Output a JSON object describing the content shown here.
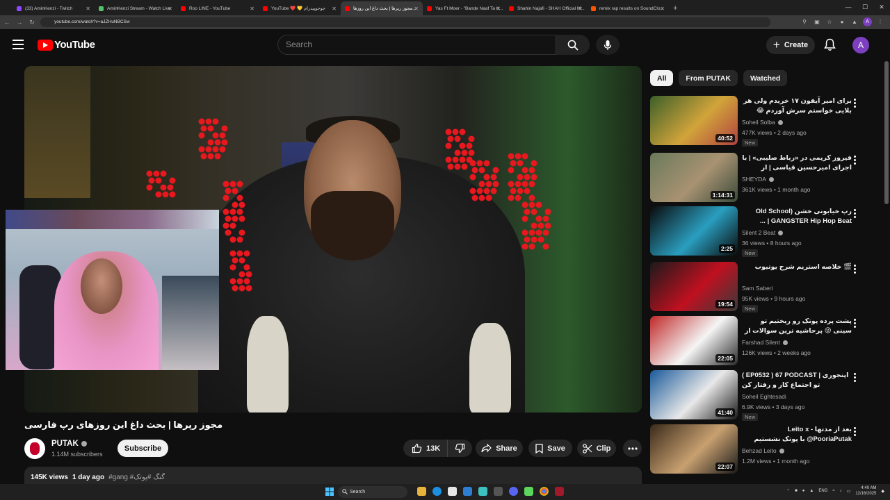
{
  "browser": {
    "tabs": [
      {
        "title": "(33) AminKenzi - Twitch",
        "color": "#9146ff",
        "active": false
      },
      {
        "title": "AminKenzi Stream - Watch Live",
        "color": "#53c16a",
        "active": false
      },
      {
        "title": "Roo LINE - YouTube",
        "color": "#ff0000",
        "active": false
      },
      {
        "title": "YouTube ❤️ 💛 جوجو‌پیدرام",
        "color": "#ff0000",
        "active": false
      },
      {
        "title": "مجوز رپرها | بحث داغ این روزها...",
        "color": "#ff0000",
        "active": true
      },
      {
        "title": "Yas Ft Moer - \"Bande Naaf Ta K...",
        "color": "#ff0000",
        "active": false
      },
      {
        "title": "Shahin Najafi - SHAH Official M...",
        "color": "#ff0000",
        "active": false
      },
      {
        "title": "remix rap results on SoundClo...",
        "color": "#ff5500",
        "active": false
      }
    ],
    "new_tab": "+",
    "url": "youtube.com/watch?v=aJZHuNBCSw"
  },
  "header": {
    "logo_text": "YouTube",
    "search_placeholder": "Search",
    "create_label": "Create",
    "account_initial": "A"
  },
  "video": {
    "title": "مجوز رپرها | بحث داغ این روزهای رپ فارسی",
    "channel": "PUTAK",
    "subscribers": "1.14M subscribers",
    "subscribe_label": "Subscribe",
    "likes": "13K",
    "share_label": "Share",
    "save_label": "Save",
    "clip_label": "Clip",
    "views": "145K views",
    "age": "1 day ago",
    "tags": "#gang #گنگ #پوتک"
  },
  "chips": [
    "All",
    "From PUTAK",
    "Watched"
  ],
  "recommendations": [
    {
      "title": "برای امیر آیفون ۱۷ خریدم ولی هر بلایی خواستم سرش آوردم 😂",
      "channel": "Soheil Solba",
      "verified": true,
      "meta": "477K views • 2 days ago",
      "badge": "New",
      "duration": "40:52",
      "thumb": [
        "#3c5f2a",
        "#d1a43a",
        "#b04040"
      ]
    },
    {
      "title": "فیروز کریمی در «رباط صلیبی» | با اجرای امیرحسین قیاسی | از پلتفرم شیدا",
      "channel": "SHEYDA",
      "verified": true,
      "meta": "361K views • 1 month ago",
      "badge": "",
      "duration": "1:14:31",
      "thumb": [
        "#6a7a5a",
        "#a89272",
        "#3a4a3a"
      ]
    },
    {
      "title": "رپ خیابونی خشن Old School) GANGSTER Hip Hop Beat | ...",
      "channel": "Silent 2 Beat",
      "verified": true,
      "meta": "36 views • 8 hours ago",
      "badge": "New",
      "duration": "2:25",
      "thumb": [
        "#0a0a0a",
        "#2a9ec0",
        "#0a0a0a"
      ]
    },
    {
      "title": "🎬 خلاصه استریم شرح یوتیوب",
      "channel": "Sam Saberi",
      "verified": false,
      "meta": "95K views • 9 hours ago",
      "badge": "New",
      "duration": "19:54",
      "thumb": [
        "#1a1a1a",
        "#c01020",
        "#3a3a3a"
      ]
    },
    {
      "title": "پشت پرده پوتک رو ریختیم تو سینی 😜 پرحاشیه ترین سوالات از پوتک",
      "channel": "Farshad Silent",
      "verified": true,
      "meta": "126K views • 2 weeks ago",
      "badge": "",
      "duration": "22:05",
      "thumb": [
        "#c02828",
        "#f5f5f5",
        "#2a2a2a"
      ]
    },
    {
      "title": "( EP0532 ) 67 PODCAST | اپنجوری تو اجتماع کار و رفتار کن",
      "channel": "Soheil Eghtesadi",
      "verified": false,
      "meta": "6.9K views • 3 days ago",
      "badge": "New",
      "duration": "41:40",
      "thumb": [
        "#1a5a9a",
        "#e8e8e8",
        "#1a1a1a"
      ]
    },
    {
      "title": "بعد از مدتها - Leito x @PooriaPutak با پوتک نشستیم",
      "channel": "Behzad Leito",
      "verified": true,
      "meta": "1.2M views • 1 month ago",
      "badge": "",
      "duration": "22:07",
      "thumb": [
        "#3a2a1a",
        "#c8a070",
        "#1a1a1a"
      ]
    }
  ],
  "taskbar": {
    "search_label": "Search",
    "lang": "ENG",
    "time": "4:40 AM",
    "date": "12/16/2025"
  },
  "colors": {
    "accent": "#ff0000",
    "background": "#0f0f0f",
    "overlay_dots": "#e8181e"
  },
  "icons": [
    "hamburger-icon",
    "youtube-logo-icon",
    "search-icon",
    "mic-icon",
    "plus-icon",
    "bell-icon",
    "like-icon",
    "dislike-icon",
    "share-icon",
    "save-icon",
    "clip-icon",
    "more-icon",
    "verified-icon",
    "windows-start-icon"
  ]
}
